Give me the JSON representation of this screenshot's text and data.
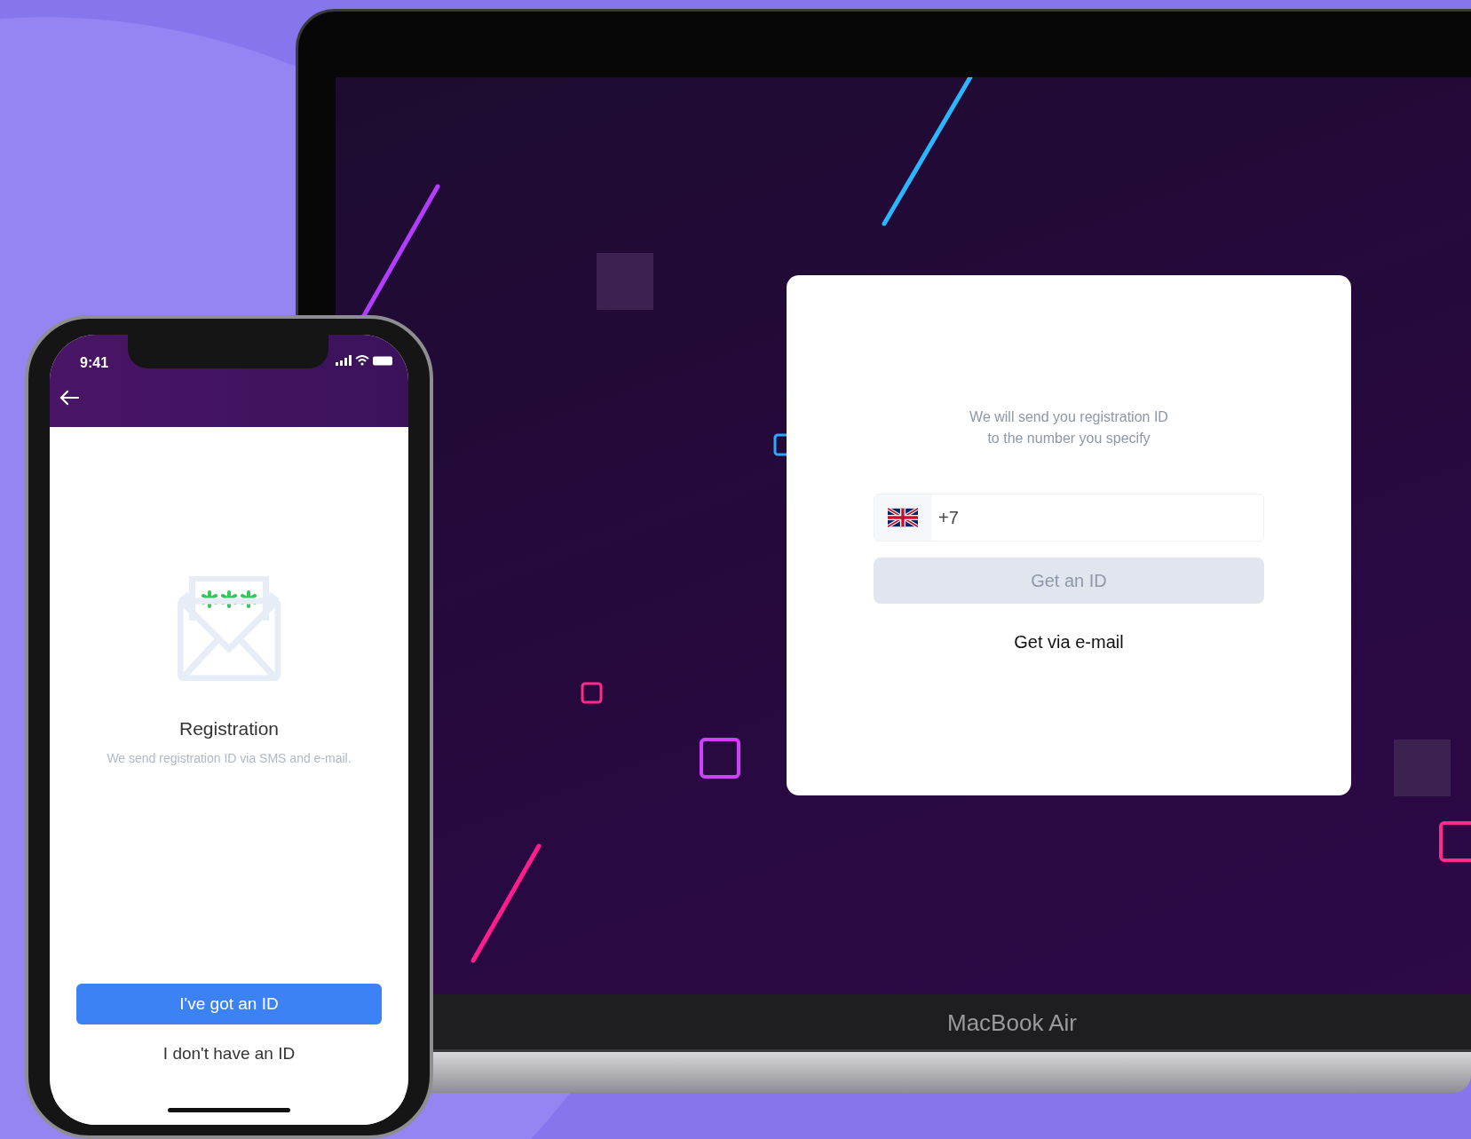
{
  "laptop": {
    "screen": {
      "message": "We will send you registration ID\nto the number you specify",
      "phone_field": {
        "value": "+7"
      },
      "submit_button": {
        "label": "Get an ID",
        "disabled": true
      },
      "email_link": "Get via e-mail"
    },
    "model_label": "MacBook Air"
  },
  "phone": {
    "status_bar": {
      "time": "9:41"
    },
    "title": "Registration",
    "subtitle": "We send registration ID via SMS and e-mail.",
    "buttons": [
      {
        "label": "I've got an ID",
        "kind": "primary"
      },
      {
        "label": "I don't have an ID",
        "kind": "text"
      }
    ]
  }
}
